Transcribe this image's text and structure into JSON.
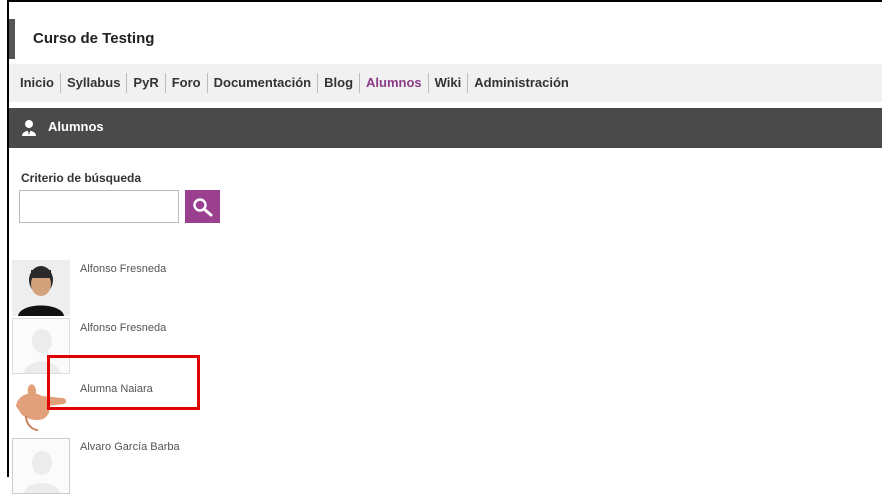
{
  "course": {
    "title": "Curso de Testing"
  },
  "nav": {
    "items": [
      {
        "label": "Inicio"
      },
      {
        "label": "Syllabus"
      },
      {
        "label": "PyR"
      },
      {
        "label": "Foro"
      },
      {
        "label": "Documentación"
      },
      {
        "label": "Blog"
      },
      {
        "label": "Alumnos",
        "active": true
      },
      {
        "label": "Wiki"
      },
      {
        "label": "Administración"
      }
    ]
  },
  "section": {
    "title": "Alumnos",
    "icon": "user-icon"
  },
  "search": {
    "label": "Criterio de búsqueda",
    "placeholder": "",
    "button_icon": "magnifier-icon"
  },
  "students": [
    {
      "name": "Alfonso Fresneda",
      "avatar": "photo-man"
    },
    {
      "name": "Alfonso Fresneda",
      "avatar": "default-silhouette"
    },
    {
      "name": "Alumna Naiara",
      "avatar": "thumbs-up-hand"
    },
    {
      "name": "Alvaro García Barba",
      "avatar": "default-silhouette"
    }
  ],
  "colors": {
    "accent": "#9b3f8f",
    "active_nav": "#8a3c88",
    "section_bar": "#4a4a4a",
    "highlight": "#e30000"
  }
}
